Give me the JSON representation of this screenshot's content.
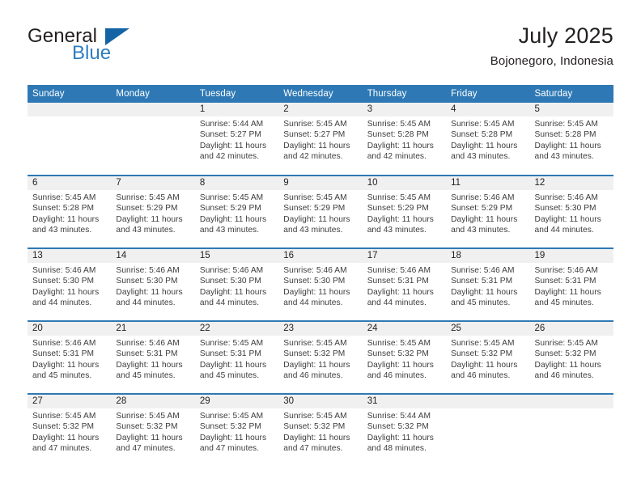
{
  "brand": {
    "name_top": "General",
    "name_bottom": "Blue",
    "triangle_icon": "triangle-logo-icon",
    "blue": "#2e7dc0",
    "dark_blue": "#1464a5"
  },
  "header": {
    "title": "July 2025",
    "subtitle": "Bojonegoro, Indonesia"
  },
  "theme": {
    "header_blue": "#2e79b5",
    "band_gray": "#f0f0f0",
    "text": "#231f20"
  },
  "calendar": {
    "weekday_headers": [
      "Sunday",
      "Monday",
      "Tuesday",
      "Wednesday",
      "Thursday",
      "Friday",
      "Saturday"
    ],
    "weeks": [
      [
        {
          "day": "",
          "lines": [
            "",
            "",
            "",
            ""
          ]
        },
        {
          "day": "",
          "lines": [
            "",
            "",
            "",
            ""
          ]
        },
        {
          "day": "1",
          "lines": [
            "Sunrise: 5:44 AM",
            "Sunset: 5:27 PM",
            "Daylight: 11 hours",
            "and 42 minutes."
          ]
        },
        {
          "day": "2",
          "lines": [
            "Sunrise: 5:45 AM",
            "Sunset: 5:27 PM",
            "Daylight: 11 hours",
            "and 42 minutes."
          ]
        },
        {
          "day": "3",
          "lines": [
            "Sunrise: 5:45 AM",
            "Sunset: 5:28 PM",
            "Daylight: 11 hours",
            "and 42 minutes."
          ]
        },
        {
          "day": "4",
          "lines": [
            "Sunrise: 5:45 AM",
            "Sunset: 5:28 PM",
            "Daylight: 11 hours",
            "and 43 minutes."
          ]
        },
        {
          "day": "5",
          "lines": [
            "Sunrise: 5:45 AM",
            "Sunset: 5:28 PM",
            "Daylight: 11 hours",
            "and 43 minutes."
          ]
        }
      ],
      [
        {
          "day": "6",
          "lines": [
            "Sunrise: 5:45 AM",
            "Sunset: 5:28 PM",
            "Daylight: 11 hours",
            "and 43 minutes."
          ]
        },
        {
          "day": "7",
          "lines": [
            "Sunrise: 5:45 AM",
            "Sunset: 5:29 PM",
            "Daylight: 11 hours",
            "and 43 minutes."
          ]
        },
        {
          "day": "8",
          "lines": [
            "Sunrise: 5:45 AM",
            "Sunset: 5:29 PM",
            "Daylight: 11 hours",
            "and 43 minutes."
          ]
        },
        {
          "day": "9",
          "lines": [
            "Sunrise: 5:45 AM",
            "Sunset: 5:29 PM",
            "Daylight: 11 hours",
            "and 43 minutes."
          ]
        },
        {
          "day": "10",
          "lines": [
            "Sunrise: 5:45 AM",
            "Sunset: 5:29 PM",
            "Daylight: 11 hours",
            "and 43 minutes."
          ]
        },
        {
          "day": "11",
          "lines": [
            "Sunrise: 5:46 AM",
            "Sunset: 5:29 PM",
            "Daylight: 11 hours",
            "and 43 minutes."
          ]
        },
        {
          "day": "12",
          "lines": [
            "Sunrise: 5:46 AM",
            "Sunset: 5:30 PM",
            "Daylight: 11 hours",
            "and 44 minutes."
          ]
        }
      ],
      [
        {
          "day": "13",
          "lines": [
            "Sunrise: 5:46 AM",
            "Sunset: 5:30 PM",
            "Daylight: 11 hours",
            "and 44 minutes."
          ]
        },
        {
          "day": "14",
          "lines": [
            "Sunrise: 5:46 AM",
            "Sunset: 5:30 PM",
            "Daylight: 11 hours",
            "and 44 minutes."
          ]
        },
        {
          "day": "15",
          "lines": [
            "Sunrise: 5:46 AM",
            "Sunset: 5:30 PM",
            "Daylight: 11 hours",
            "and 44 minutes."
          ]
        },
        {
          "day": "16",
          "lines": [
            "Sunrise: 5:46 AM",
            "Sunset: 5:30 PM",
            "Daylight: 11 hours",
            "and 44 minutes."
          ]
        },
        {
          "day": "17",
          "lines": [
            "Sunrise: 5:46 AM",
            "Sunset: 5:31 PM",
            "Daylight: 11 hours",
            "and 44 minutes."
          ]
        },
        {
          "day": "18",
          "lines": [
            "Sunrise: 5:46 AM",
            "Sunset: 5:31 PM",
            "Daylight: 11 hours",
            "and 45 minutes."
          ]
        },
        {
          "day": "19",
          "lines": [
            "Sunrise: 5:46 AM",
            "Sunset: 5:31 PM",
            "Daylight: 11 hours",
            "and 45 minutes."
          ]
        }
      ],
      [
        {
          "day": "20",
          "lines": [
            "Sunrise: 5:46 AM",
            "Sunset: 5:31 PM",
            "Daylight: 11 hours",
            "and 45 minutes."
          ]
        },
        {
          "day": "21",
          "lines": [
            "Sunrise: 5:46 AM",
            "Sunset: 5:31 PM",
            "Daylight: 11 hours",
            "and 45 minutes."
          ]
        },
        {
          "day": "22",
          "lines": [
            "Sunrise: 5:45 AM",
            "Sunset: 5:31 PM",
            "Daylight: 11 hours",
            "and 45 minutes."
          ]
        },
        {
          "day": "23",
          "lines": [
            "Sunrise: 5:45 AM",
            "Sunset: 5:32 PM",
            "Daylight: 11 hours",
            "and 46 minutes."
          ]
        },
        {
          "day": "24",
          "lines": [
            "Sunrise: 5:45 AM",
            "Sunset: 5:32 PM",
            "Daylight: 11 hours",
            "and 46 minutes."
          ]
        },
        {
          "day": "25",
          "lines": [
            "Sunrise: 5:45 AM",
            "Sunset: 5:32 PM",
            "Daylight: 11 hours",
            "and 46 minutes."
          ]
        },
        {
          "day": "26",
          "lines": [
            "Sunrise: 5:45 AM",
            "Sunset: 5:32 PM",
            "Daylight: 11 hours",
            "and 46 minutes."
          ]
        }
      ],
      [
        {
          "day": "27",
          "lines": [
            "Sunrise: 5:45 AM",
            "Sunset: 5:32 PM",
            "Daylight: 11 hours",
            "and 47 minutes."
          ]
        },
        {
          "day": "28",
          "lines": [
            "Sunrise: 5:45 AM",
            "Sunset: 5:32 PM",
            "Daylight: 11 hours",
            "and 47 minutes."
          ]
        },
        {
          "day": "29",
          "lines": [
            "Sunrise: 5:45 AM",
            "Sunset: 5:32 PM",
            "Daylight: 11 hours",
            "and 47 minutes."
          ]
        },
        {
          "day": "30",
          "lines": [
            "Sunrise: 5:45 AM",
            "Sunset: 5:32 PM",
            "Daylight: 11 hours",
            "and 47 minutes."
          ]
        },
        {
          "day": "31",
          "lines": [
            "Sunrise: 5:44 AM",
            "Sunset: 5:32 PM",
            "Daylight: 11 hours",
            "and 48 minutes."
          ]
        },
        {
          "day": "",
          "lines": [
            "",
            "",
            "",
            ""
          ]
        },
        {
          "day": "",
          "lines": [
            "",
            "",
            "",
            ""
          ]
        }
      ]
    ]
  }
}
